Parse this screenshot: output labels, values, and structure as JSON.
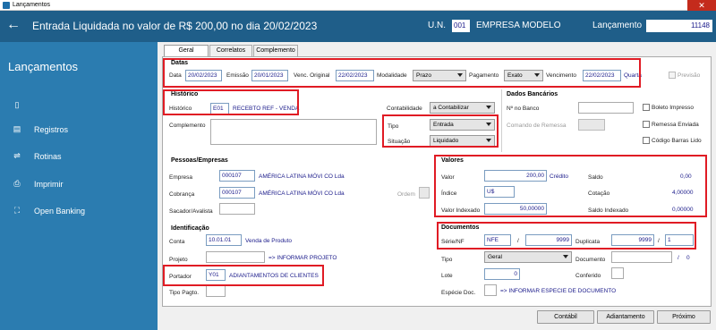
{
  "window": {
    "title": "Lançamentos",
    "close_glyph": "✕"
  },
  "header": {
    "back_glyph": "←",
    "title": "Entrada Liquidada no valor de R$ 200,00 no dia 20/02/2023",
    "un_label": "U.N.",
    "un_value": "001",
    "empresa": "EMPRESA MODELO",
    "lancamento_label": "Lançamento",
    "lancamento_value": "11148"
  },
  "sidebar": {
    "title": "Lançamentos",
    "items": [
      {
        "label": "",
        "icon": "dot-icon"
      },
      {
        "label": "Registros",
        "icon": "registros-icon"
      },
      {
        "label": "Rotinas",
        "icon": "rotinas-icon"
      },
      {
        "label": "Imprimir",
        "icon": "printer-icon"
      },
      {
        "label": "Open Banking",
        "icon": "bank-icon"
      }
    ]
  },
  "tabs": [
    {
      "label": "Geral"
    },
    {
      "label": "Correlatos"
    },
    {
      "label": "Complemento"
    }
  ],
  "datas": {
    "title": "Datas",
    "data_label": "Data",
    "data_value": "20/02/2023",
    "emissao_label": "Emissão",
    "emissao_value": "20/01/2023",
    "venc_label": "Venc. Original",
    "venc_value": "22/02/2023",
    "modalidade_label": "Modalidade",
    "modalidade_value": "Prazo",
    "pagamento_label": "Pagamento",
    "pagamento_value": "Exato",
    "vencimento_label": "Vencimento",
    "vencimento_value": "22/02/2023",
    "dia_semana": "Quarta",
    "previsao_label": "Previsão"
  },
  "historico": {
    "title": "Histórico",
    "label": "Histórico",
    "code": "E01",
    "desc": "RECEBTO REF - VENDA",
    "complemento_label": "Complemento",
    "contabilidade_label": "Contabilidade",
    "contabilidade_value": "a Contabilizar",
    "tipo_label": "Tipo",
    "tipo_value": "Entrada",
    "situacao_label": "Situação",
    "situacao_value": "Liquidado"
  },
  "dados_bancarios": {
    "title": "Dados Bancários",
    "no_banco_label": "Nº no Banco",
    "comando_label": "Comando de Remessa",
    "boleto_label": "Boleto Impresso",
    "remessa_label": "Remessa Enviada",
    "codigo_label": "Código Barras Lido"
  },
  "pessoas": {
    "title": "Pessoas/Empresas",
    "empresa_label": "Empresa",
    "empresa_code": "000107",
    "empresa_name": "AMÉRICA LATINA MÓVI CO Lda",
    "cobranca_label": "Cobrança",
    "cobranca_code": "000107",
    "cobranca_name": "AMÉRICA LATINA MÓVI CO Lda",
    "ordem_label": "Ordem",
    "sacador_label": "Sacador/Avalista"
  },
  "valores": {
    "title": "Valores",
    "valor_label": "Valor",
    "valor_value": "200,00",
    "valor_tipo": "Crédito",
    "saldo_label": "Saldo",
    "saldo_value": "0,00",
    "indice_label": "Índice",
    "indice_value": "U$",
    "cotacao_label": "Cotação",
    "cotacao_value": "4,00000",
    "indexado_label": "Valor Indexado",
    "indexado_value": "50,00000",
    "saldo_indexado_label": "Saldo Indexado",
    "saldo_indexado_value": "0,00000"
  },
  "identificacao": {
    "title": "Identificação",
    "conta_label": "Conta",
    "conta_code": "10.01.01",
    "conta_desc": "Venda de Produto",
    "projeto_label": "Projeto",
    "projeto_hint": "=> INFORMAR PROJETO",
    "portador_label": "Portador",
    "portador_code": "Y01",
    "portador_desc": "ADIANTAMENTOS DE CLIENTES",
    "tipo_pagto_label": "Tipo Pagto."
  },
  "documentos": {
    "title": "Documentos",
    "serie_label": "Série/NF",
    "serie_value": "NFE",
    "slash1": "/",
    "nf_value": "9999",
    "duplicata_label": "Duplicata",
    "duplicata_value": "9999",
    "slash2": "/",
    "parcela_value": "1",
    "tipo_label": "Tipo",
    "tipo_value": "Geral",
    "documento_label": "Documento",
    "documento_sep": "/",
    "documento_count": "0",
    "lote_label": "Lote",
    "lote_value": "0",
    "conferido_label": "Conferido",
    "especie_label": "Espécie Doc.",
    "especie_hint": "=> INFORMAR ESPECIE DE DOCUMENTO"
  },
  "buttons": {
    "contabil": "Contábil",
    "adiantamento": "Adiantamento",
    "proximo": "Próximo"
  },
  "colors": {
    "header": "#1f5e89",
    "sidebar": "#2b7cb0",
    "highlight": "#e01b24",
    "value_text": "#1a1a8a"
  }
}
